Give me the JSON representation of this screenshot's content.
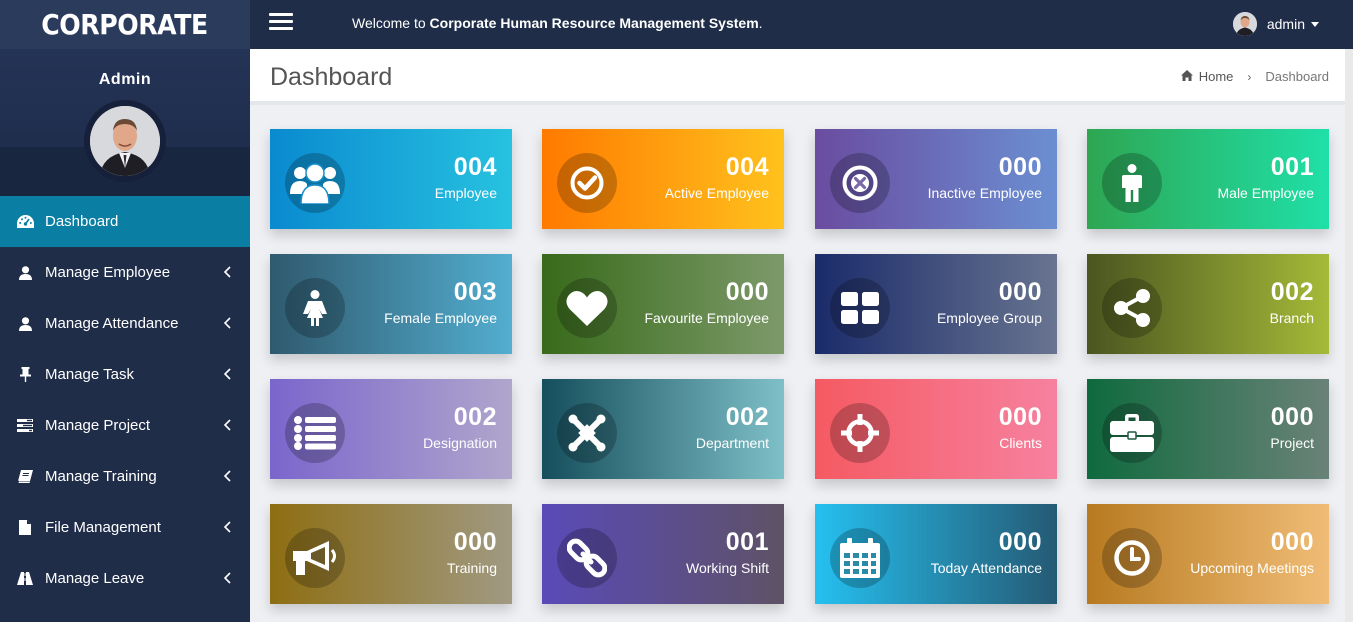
{
  "brand": {
    "title": "CORPORATE"
  },
  "profile": {
    "name": "Admin"
  },
  "topbar": {
    "welcome_prefix": "Welcome to ",
    "welcome_system": "Corporate Human Resource Management System",
    "welcome_suffix": ".",
    "user_name": "admin"
  },
  "header": {
    "title": "Dashboard",
    "breadcrumb_home": "Home",
    "breadcrumb_current": "Dashboard"
  },
  "sidebar": {
    "items": [
      {
        "label": "Dashboard",
        "icon": "dashboard-icon",
        "active": true
      },
      {
        "label": "Manage Employee",
        "icon": "user-icon"
      },
      {
        "label": "Manage Attendance",
        "icon": "user-icon"
      },
      {
        "label": "Manage Task",
        "icon": "pin-icon"
      },
      {
        "label": "Manage Project",
        "icon": "tasks-icon"
      },
      {
        "label": "Manage Training",
        "icon": "book-icon"
      },
      {
        "label": "File Management",
        "icon": "file-icon"
      },
      {
        "label": "Manage Leave",
        "icon": "road-icon"
      }
    ]
  },
  "cards": [
    {
      "count": "004",
      "label": "Employee",
      "icon": "users-icon",
      "gradient": [
        "#0a8ad0",
        "#27c2e0"
      ]
    },
    {
      "count": "004",
      "label": "Active Employee",
      "icon": "check-circle-icon",
      "gradient": [
        "#ff7a00",
        "#ffc21d"
      ]
    },
    {
      "count": "000",
      "label": "Inactive Employee",
      "icon": "times-circle-icon",
      "gradient": [
        "#6a4ca0",
        "#6b8fd2"
      ]
    },
    {
      "count": "001",
      "label": "Male Employee",
      "icon": "male-icon",
      "gradient": [
        "#2ea652",
        "#1fe0a8"
      ]
    },
    {
      "count": "003",
      "label": "Female Employee",
      "icon": "female-icon",
      "gradient": [
        "#2f5a6e",
        "#53aed0"
      ]
    },
    {
      "count": "000",
      "label": "Favourite Employee",
      "icon": "heart-icon",
      "gradient": [
        "#386a1a",
        "#7d9a6a"
      ]
    },
    {
      "count": "000",
      "label": "Employee Group",
      "icon": "th-large-icon",
      "gradient": [
        "#1a2b6a",
        "#687490"
      ]
    },
    {
      "count": "002",
      "label": "Branch",
      "icon": "share-icon",
      "gradient": [
        "#4a5520",
        "#a5ba38"
      ]
    },
    {
      "count": "002",
      "label": "Designation",
      "icon": "list-icon",
      "gradient": [
        "#7a66cc",
        "#b0a6cc"
      ]
    },
    {
      "count": "002",
      "label": "Department",
      "icon": "joomla-icon",
      "gradient": [
        "#154e5c",
        "#7ec0c8"
      ]
    },
    {
      "count": "000",
      "label": "Clients",
      "icon": "crosshairs-icon",
      "gradient": [
        "#f55a62",
        "#f6819f"
      ]
    },
    {
      "count": "000",
      "label": "Project",
      "icon": "briefcase-icon",
      "gradient": [
        "#0f6a3e",
        "#6a8278"
      ]
    },
    {
      "count": "000",
      "label": "Training",
      "icon": "bullhorn-icon",
      "gradient": [
        "#8e6e12",
        "#a09a82"
      ]
    },
    {
      "count": "001",
      "label": "Working Shift",
      "icon": "chain-icon",
      "gradient": [
        "#5a4ab8",
        "#5e5266"
      ]
    },
    {
      "count": "000",
      "label": "Today Attendance",
      "icon": "calendar-icon",
      "gradient": [
        "#25c0f0",
        "#255a74"
      ]
    },
    {
      "count": "000",
      "label": "Upcoming Meetings",
      "icon": "clock-icon",
      "gradient": [
        "#b77a20",
        "#f0bc76"
      ]
    }
  ]
}
